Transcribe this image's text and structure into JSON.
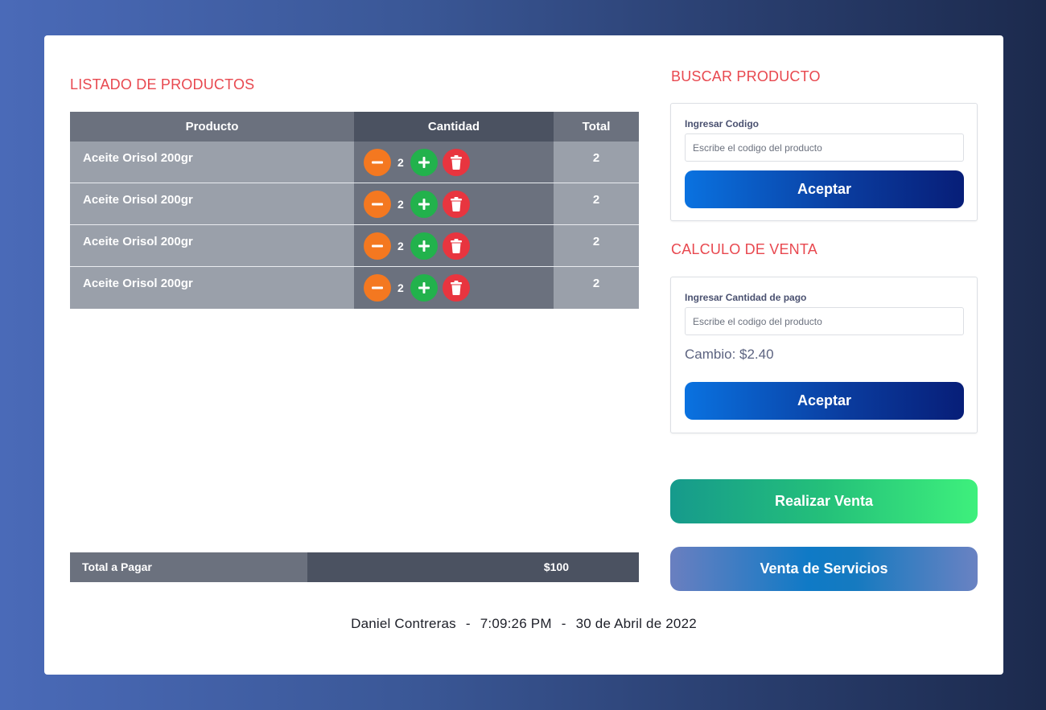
{
  "list": {
    "title": "LISTADO DE PRODUCTOS",
    "headers": {
      "product": "Producto",
      "quantity": "Cantidad",
      "total": "Total"
    },
    "rows": [
      {
        "product": "Aceite Orisol 200gr",
        "qty": "2",
        "total": "2"
      },
      {
        "product": "Aceite Orisol 200gr",
        "qty": "2",
        "total": "2"
      },
      {
        "product": "Aceite Orisol 200gr",
        "qty": "2",
        "total": "2"
      },
      {
        "product": "Aceite Orisol 200gr",
        "qty": "2",
        "total": "2"
      }
    ],
    "total_label": "Total a Pagar",
    "total_value": "$100"
  },
  "search": {
    "title": "BUSCAR PRODUCTO",
    "label": "Ingresar Codigo",
    "placeholder": "Escribe el codigo del producto",
    "button": "Aceptar"
  },
  "calc": {
    "title": "CALCULO DE VENTA",
    "label": "Ingresar Cantidad de pago",
    "placeholder": "Escribe el codigo del producto",
    "change": "Cambio: $2.40",
    "button": "Aceptar"
  },
  "actions": {
    "sale": "Realizar Venta",
    "service": "Venta de Servicios"
  },
  "footer": {
    "user": "Daniel Contreras",
    "time": "7:09:26 PM",
    "date": "30 de Abril de 2022",
    "separator": "-"
  },
  "colors": {
    "accent_red": "#e8484f",
    "minus": "#f47820",
    "plus": "#22b24c",
    "trash": "#e8353f"
  },
  "icons": [
    "minus-icon",
    "plus-icon",
    "trash-icon"
  ]
}
